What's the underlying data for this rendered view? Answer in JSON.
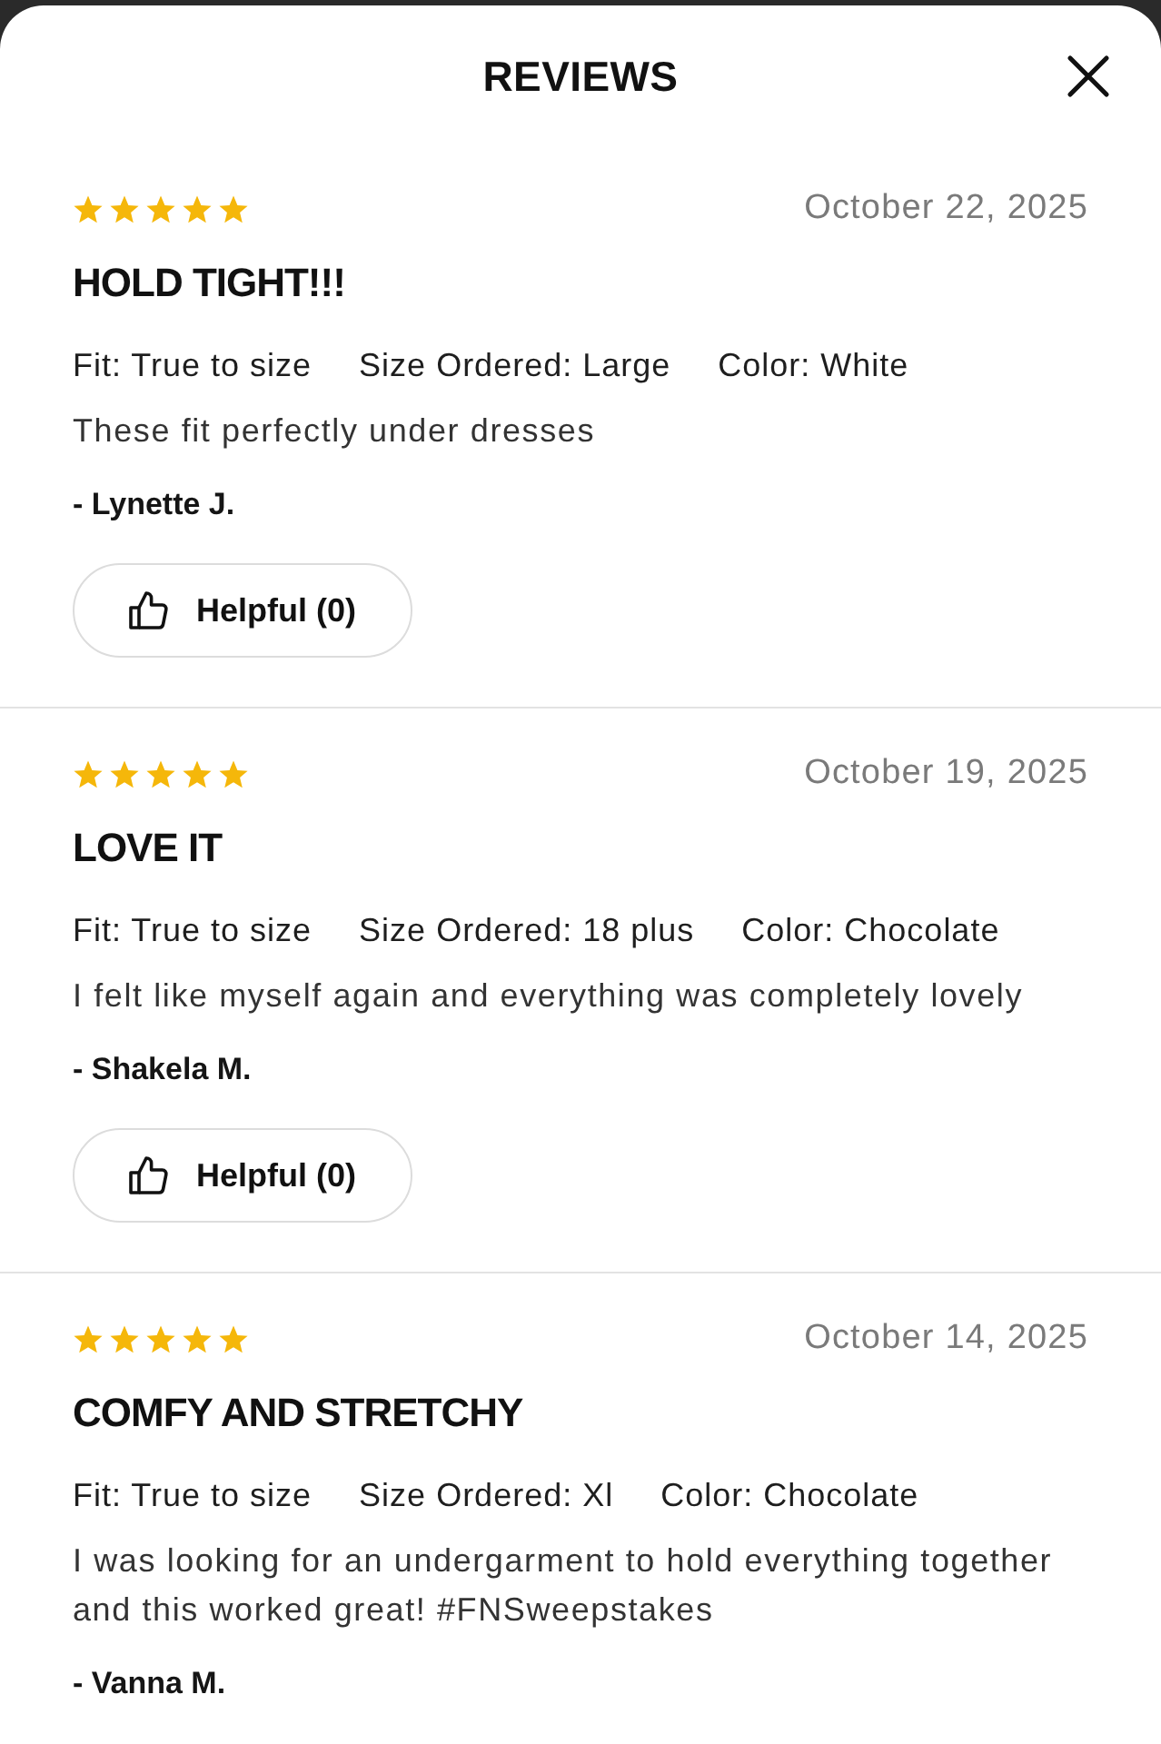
{
  "modal": {
    "title": "REVIEWS"
  },
  "reviews": [
    {
      "stars": 5,
      "date": "October 22, 2025",
      "title": "HOLD TIGHT!!!",
      "attributes": [
        "Fit: True to size",
        "Size Ordered: Large",
        "Color: White"
      ],
      "text": "These fit perfectly under dresses",
      "author": "- Lynette J.",
      "helpful": "Helpful (0)"
    },
    {
      "stars": 5,
      "date": "October 19, 2025",
      "title": "LOVE IT",
      "attributes": [
        "Fit: True to size",
        "Size Ordered: 18 plus",
        "Color: Chocolate"
      ],
      "text": "I felt like myself again and everything was completely lovely",
      "author": "- Shakela M.",
      "helpful": "Helpful (0)"
    },
    {
      "stars": 5,
      "date": "October 14, 2025",
      "title": "COMFY AND STRETCHY",
      "attributes": [
        "Fit: True to size",
        "Size Ordered: Xl",
        "Color: Chocolate"
      ],
      "text": "I was looking for an undergarment to hold everything together and this worked great! #FNSweepstakes",
      "author": "- Vanna M."
    }
  ]
}
